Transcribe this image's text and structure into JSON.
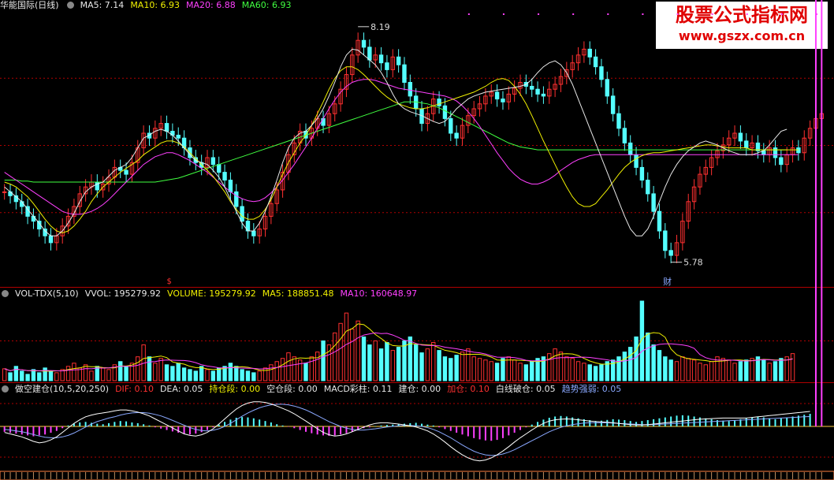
{
  "main_header": {
    "title": "华能国际(日线)",
    "ma5": "MA5: 7.14",
    "ma10": "MA10: 6.93",
    "ma20": "MA20: 6.88",
    "ma60": "MA60: 6.93"
  },
  "main_annotations": {
    "high": "8.19",
    "low": "5.78",
    "marker_s": "$",
    "marker_cai": "财"
  },
  "vol_header": {
    "name": "VOL-TDX(5,10)",
    "vvol": "VVOL: 195279.92",
    "volume": "VOLUME: 195279.92",
    "ma5": "MA5: 188851.48",
    "ma10": "MA10: 160648.97"
  },
  "macd_header": {
    "name": "做空建仓(10,5,20,250)",
    "dif": "DIF: 0.10",
    "dea": "DEA: 0.05",
    "hold": "持仓段: 0.00",
    "empty": "空仓段: 0.00",
    "bar": "MACD彩柱: 0.11",
    "build": "建仓: 0.00",
    "add": "加仓: 0.10",
    "break": "白线破仓: 0.05",
    "trend": "趋势强弱: 0.05"
  },
  "watermark": {
    "title": "股票公式指标网",
    "url": "www.gszx.com.cn"
  },
  "colors": {
    "up": "#ff3030",
    "down": "#54ffff",
    "ma5": "#e8e8e8",
    "ma10": "#f0f000",
    "ma20": "#ff40ff",
    "ma60": "#40ff40",
    "grid": "#b00000"
  },
  "icons": [
    "dot-icon"
  ],
  "chart_data": {
    "type": "candlestick",
    "price_range": [
      5.6,
      8.35
    ],
    "high_mark": 8.19,
    "low_mark": 5.78,
    "closes": [
      6.5,
      6.46,
      6.4,
      6.35,
      6.25,
      6.2,
      6.12,
      6.05,
      5.98,
      6.05,
      6.15,
      6.25,
      6.35,
      6.48,
      6.55,
      6.6,
      6.52,
      6.58,
      6.65,
      6.75,
      6.72,
      6.68,
      6.8,
      6.95,
      7.1,
      7.05,
      7.15,
      7.2,
      7.12,
      7.08,
      7.05,
      6.95,
      6.85,
      6.8,
      6.75,
      6.85,
      6.78,
      6.7,
      6.62,
      6.5,
      6.35,
      6.2,
      6.1,
      6.05,
      6.12,
      6.25,
      6.38,
      6.52,
      6.7,
      6.88,
      7.0,
      7.12,
      7.05,
      7.15,
      7.25,
      7.18,
      7.3,
      7.4,
      7.55,
      7.7,
      7.9,
      8.05,
      7.98,
      7.85,
      7.9,
      7.82,
      7.75,
      7.88,
      7.8,
      7.62,
      7.48,
      7.35,
      7.2,
      7.3,
      7.45,
      7.38,
      7.25,
      7.1,
      7.05,
      7.18,
      7.28,
      7.35,
      7.4,
      7.48,
      7.52,
      7.45,
      7.42,
      7.5,
      7.56,
      7.62,
      7.58,
      7.55,
      7.5,
      7.48,
      7.55,
      7.6,
      7.68,
      7.75,
      7.82,
      7.9,
      7.96,
      7.88,
      7.78,
      7.65,
      7.48,
      7.3,
      7.15,
      7.0,
      6.88,
      6.75,
      6.62,
      6.48,
      6.3,
      6.1,
      5.9,
      5.85,
      5.98,
      6.2,
      6.4,
      6.55,
      6.68,
      6.75,
      6.85,
      6.92,
      6.98,
      7.05,
      7.1,
      7.02,
      6.95,
      7.0,
      6.92,
      6.88,
      6.95,
      6.85,
      6.78,
      6.88,
      6.95,
      6.9,
      7.05,
      7.15,
      7.25,
      7.3
    ],
    "ma5": [
      6.55,
      6.5,
      6.45,
      6.4,
      6.32,
      6.25,
      6.18,
      6.1,
      6.05,
      6.05,
      6.1,
      6.18,
      6.28,
      6.4,
      6.5,
      6.55,
      6.58,
      6.6,
      6.66,
      6.72,
      6.75,
      6.78,
      6.85,
      6.95,
      7.05,
      7.08,
      7.12,
      7.14,
      7.12,
      7.08,
      7.02,
      6.95,
      6.88,
      6.82,
      6.8,
      6.78,
      6.72,
      6.65,
      6.55,
      6.42,
      6.3,
      6.18,
      6.1,
      6.1,
      6.18,
      6.3,
      6.45,
      6.62,
      6.8,
      6.95,
      7.05,
      7.1,
      7.12,
      7.18,
      7.25,
      7.35,
      7.48,
      7.62,
      7.78,
      7.9,
      7.96,
      7.95,
      7.9,
      7.85,
      7.8,
      7.72,
      7.62,
      7.5,
      7.4,
      7.35,
      7.32,
      7.3,
      7.28,
      7.25,
      7.22,
      7.2,
      7.22,
      7.28,
      7.35,
      7.4,
      7.45,
      7.48,
      7.5,
      7.52,
      7.53,
      7.54,
      7.55,
      7.56,
      7.57,
      7.58,
      7.6,
      7.65,
      7.72,
      7.78,
      7.82,
      7.84,
      7.8,
      7.72,
      7.6,
      7.45,
      7.3,
      7.15,
      7.0,
      6.85,
      6.7,
      6.55,
      6.4,
      6.25,
      6.12,
      6.05,
      6.05,
      6.12,
      6.25,
      6.4,
      6.55,
      6.68,
      6.78,
      6.86,
      6.92,
      6.96,
      7.0,
      7.02,
      7.0,
      6.98,
      6.95,
      6.92,
      6.9,
      6.88,
      6.88,
      6.88,
      6.9,
      6.92,
      6.98,
      7.05,
      7.12,
      7.14
    ],
    "ma10": [
      6.6,
      6.58,
      6.55,
      6.5,
      6.45,
      6.38,
      6.3,
      6.22,
      6.15,
      6.1,
      6.08,
      6.1,
      6.15,
      6.22,
      6.3,
      6.4,
      6.48,
      6.55,
      6.6,
      6.65,
      6.7,
      6.74,
      6.78,
      6.82,
      6.88,
      6.92,
      6.96,
      7.0,
      7.02,
      7.02,
      7.0,
      6.96,
      6.9,
      6.84,
      6.78,
      6.72,
      6.66,
      6.58,
      6.5,
      6.4,
      6.32,
      6.25,
      6.22,
      6.22,
      6.25,
      6.32,
      6.42,
      6.55,
      6.68,
      6.8,
      6.9,
      7.0,
      7.08,
      7.18,
      7.3,
      7.42,
      7.55,
      7.66,
      7.74,
      7.78,
      7.78,
      7.75,
      7.7,
      7.64,
      7.58,
      7.52,
      7.47,
      7.43,
      7.4,
      7.38,
      7.36,
      7.35,
      7.35,
      7.36,
      7.38,
      7.4,
      7.42,
      7.44,
      7.46,
      7.48,
      7.5,
      7.52,
      7.55,
      7.58,
      7.62,
      7.65,
      7.66,
      7.64,
      7.58,
      7.5,
      7.4,
      7.28,
      7.15,
      7.02,
      6.9,
      6.78,
      6.66,
      6.55,
      6.45,
      6.38,
      6.35,
      6.35,
      6.38,
      6.45,
      6.52,
      6.6,
      6.68,
      6.75,
      6.8,
      6.84,
      6.87,
      6.89,
      6.9,
      6.9,
      6.91,
      6.92,
      6.93,
      6.94,
      6.95,
      6.96,
      6.97,
      6.98,
      6.98,
      6.97,
      6.96,
      6.95,
      6.95,
      6.95,
      6.95,
      6.93,
      6.93,
      6.93,
      6.93,
      6.93,
      6.93,
      6.93,
      6.93,
      6.93
    ],
    "ma20": [
      6.7,
      6.66,
      6.62,
      6.58,
      6.54,
      6.5,
      6.46,
      6.42,
      6.38,
      6.34,
      6.3,
      6.28,
      6.27,
      6.27,
      6.28,
      6.3,
      6.33,
      6.37,
      6.42,
      6.48,
      6.54,
      6.6,
      6.66,
      6.72,
      6.78,
      6.82,
      6.86,
      6.88,
      6.9,
      6.9,
      6.88,
      6.85,
      6.82,
      6.78,
      6.74,
      6.7,
      6.65,
      6.6,
      6.55,
      6.5,
      6.46,
      6.43,
      6.41,
      6.4,
      6.41,
      6.44,
      6.49,
      6.55,
      6.62,
      6.7,
      6.78,
      6.87,
      6.96,
      7.05,
      7.15,
      7.25,
      7.35,
      7.44,
      7.52,
      7.58,
      7.62,
      7.64,
      7.65,
      7.65,
      7.64,
      7.62,
      7.6,
      7.58,
      7.56,
      7.55,
      7.54,
      7.53,
      7.52,
      7.51,
      7.5,
      7.49,
      7.48,
      7.46,
      7.43,
      7.38,
      7.32,
      7.25,
      7.17,
      7.08,
      6.99,
      6.9,
      6.82,
      6.74,
      6.68,
      6.63,
      6.6,
      6.58,
      6.58,
      6.6,
      6.63,
      6.67,
      6.72,
      6.76,
      6.8,
      6.83,
      6.85,
      6.87,
      6.88,
      6.88,
      6.88,
      6.88,
      6.88,
      6.88,
      6.88,
      6.88,
      6.88,
      6.88,
      6.88,
      6.88,
      6.88,
      6.88,
      6.88,
      6.88,
      6.88,
      6.88,
      6.88,
      6.88,
      6.88,
      6.88,
      6.88,
      6.88,
      6.88,
      6.88,
      6.88,
      6.88,
      6.88,
      6.88,
      6.88,
      6.88,
      6.88,
      6.88,
      6.88,
      6.88
    ],
    "ma60": [
      6.62,
      6.62,
      6.62,
      6.61,
      6.61,
      6.6,
      6.6,
      6.6,
      6.6,
      6.6,
      6.6,
      6.6,
      6.6,
      6.6,
      6.6,
      6.6,
      6.6,
      6.6,
      6.6,
      6.6,
      6.6,
      6.6,
      6.6,
      6.6,
      6.6,
      6.6,
      6.6,
      6.61,
      6.62,
      6.63,
      6.64,
      6.66,
      6.68,
      6.7,
      6.72,
      6.74,
      6.76,
      6.78,
      6.8,
      6.82,
      6.84,
      6.86,
      6.88,
      6.9,
      6.92,
      6.94,
      6.96,
      6.98,
      7.0,
      7.02,
      7.04,
      7.06,
      7.08,
      7.1,
      7.12,
      7.14,
      7.16,
      7.18,
      7.2,
      7.22,
      7.24,
      7.26,
      7.28,
      7.3,
      7.32,
      7.34,
      7.36,
      7.38,
      7.4,
      7.42,
      7.42,
      7.42,
      7.41,
      7.4,
      7.38,
      7.36,
      7.33,
      7.3,
      7.27,
      7.24,
      7.21,
      7.18,
      7.15,
      7.12,
      7.09,
      7.06,
      7.03,
      7.0,
      6.98,
      6.96,
      6.95,
      6.94,
      6.93,
      6.93,
      6.93,
      6.93,
      6.93,
      6.93,
      6.93,
      6.93,
      6.93,
      6.93,
      6.93,
      6.93,
      6.93,
      6.93,
      6.93,
      6.93,
      6.93,
      6.93,
      6.93,
      6.93,
      6.93,
      6.93,
      6.93,
      6.93,
      6.93,
      6.93,
      6.93,
      6.93,
      6.93,
      6.93,
      6.93,
      6.93,
      6.93,
      6.93,
      6.93,
      6.93,
      6.93,
      6.93,
      6.93,
      6.93,
      6.93,
      6.93,
      6.93,
      6.93
    ],
    "volume_rel": [
      0.15,
      0.1,
      0.18,
      0.12,
      0.08,
      0.14,
      0.1,
      0.16,
      0.12,
      0.1,
      0.14,
      0.18,
      0.22,
      0.16,
      0.2,
      0.12,
      0.18,
      0.16,
      0.14,
      0.2,
      0.24,
      0.18,
      0.22,
      0.3,
      0.45,
      0.3,
      0.22,
      0.28,
      0.2,
      0.18,
      0.22,
      0.16,
      0.14,
      0.12,
      0.18,
      0.14,
      0.12,
      0.16,
      0.18,
      0.22,
      0.18,
      0.14,
      0.12,
      0.1,
      0.12,
      0.16,
      0.2,
      0.24,
      0.28,
      0.35,
      0.3,
      0.26,
      0.22,
      0.3,
      0.36,
      0.5,
      0.45,
      0.6,
      0.72,
      0.85,
      0.65,
      0.75,
      0.55,
      0.45,
      0.5,
      0.4,
      0.48,
      0.38,
      0.42,
      0.5,
      0.55,
      0.45,
      0.35,
      0.4,
      0.48,
      0.38,
      0.3,
      0.28,
      0.32,
      0.36,
      0.4,
      0.3,
      0.28,
      0.26,
      0.24,
      0.22,
      0.28,
      0.3,
      0.26,
      0.22,
      0.2,
      0.24,
      0.28,
      0.3,
      0.34,
      0.4,
      0.36,
      0.3,
      0.28,
      0.24,
      0.22,
      0.2,
      0.18,
      0.2,
      0.24,
      0.26,
      0.3,
      0.36,
      0.42,
      0.55,
      1.0,
      0.6,
      0.45,
      0.38,
      0.3,
      0.26,
      0.24,
      0.3,
      0.28,
      0.26,
      0.22,
      0.2,
      0.24,
      0.3,
      0.28,
      0.26,
      0.22,
      0.24,
      0.26,
      0.28,
      0.3,
      0.26,
      0.22,
      0.24,
      0.28,
      0.3,
      0.34
    ],
    "macd_rel": [
      -0.3,
      -0.35,
      -0.4,
      -0.45,
      -0.5,
      -0.55,
      -0.5,
      -0.45,
      -0.35,
      -0.25,
      -0.1,
      0.05,
      0.15,
      0.22,
      0.25,
      0.2,
      0.15,
      0.12,
      0.18,
      0.25,
      0.3,
      0.28,
      0.22,
      0.18,
      0.12,
      0.05,
      -0.05,
      -0.12,
      -0.2,
      -0.28,
      -0.35,
      -0.42,
      -0.45,
      -0.4,
      -0.32,
      -0.2,
      -0.05,
      0.1,
      0.25,
      0.38,
      0.48,
      0.52,
      0.5,
      0.45,
      0.38,
      0.3,
      0.22,
      0.12,
      0.05,
      -0.02,
      -0.1,
      -0.2,
      -0.3,
      -0.38,
      -0.45,
      -0.5,
      -0.52,
      -0.5,
      -0.45,
      -0.38,
      -0.3,
      -0.2,
      -0.1,
      -0.05,
      0.02,
      0.05,
      0.08,
      0.1,
      0.12,
      0.15,
      0.18,
      0.2,
      0.15,
      0.1,
      0.05,
      -0.05,
      -0.15,
      -0.25,
      -0.35,
      -0.45,
      -0.55,
      -0.65,
      -0.72,
      -0.78,
      -0.8,
      -0.75,
      -0.65,
      -0.5,
      -0.35,
      -0.2,
      -0.05,
      0.1,
      0.25,
      0.38,
      0.48,
      0.55,
      0.58,
      0.55,
      0.5,
      0.45,
      0.4,
      0.35,
      0.3,
      0.32,
      0.36,
      0.4,
      0.38,
      0.35,
      0.3,
      0.25,
      0.3,
      0.35,
      0.4,
      0.45,
      0.5,
      0.55,
      0.6,
      0.62,
      0.6,
      0.55,
      0.5,
      0.45,
      0.4,
      0.35,
      0.32,
      0.3,
      0.35,
      0.4,
      0.45,
      0.5,
      0.55,
      0.5,
      0.45,
      0.4,
      0.45,
      0.5,
      0.55,
      0.6,
      0.65,
      0.7
    ],
    "dif_rel": [
      -0.2,
      -0.25,
      -0.3,
      -0.35,
      -0.42,
      -0.5,
      -0.55,
      -0.52,
      -0.45,
      -0.35,
      -0.2,
      -0.05,
      0.1,
      0.22,
      0.32,
      0.38,
      0.42,
      0.45,
      0.48,
      0.52,
      0.55,
      0.55,
      0.52,
      0.48,
      0.42,
      0.35,
      0.25,
      0.15,
      0.05,
      -0.05,
      -0.15,
      -0.25,
      -0.3,
      -0.32,
      -0.28,
      -0.2,
      -0.08,
      0.08,
      0.25,
      0.42,
      0.58,
      0.7,
      0.78,
      0.82,
      0.82,
      0.8,
      0.75,
      0.68,
      0.6,
      0.52,
      0.42,
      0.3,
      0.18,
      0.05,
      -0.08,
      -0.2,
      -0.28,
      -0.32,
      -0.3,
      -0.25,
      -0.18,
      -0.1,
      -0.02,
      0.05,
      0.1,
      0.12,
      0.12,
      0.1,
      0.08,
      0.05,
      0.02,
      -0.02,
      -0.08,
      -0.15,
      -0.25,
      -0.38,
      -0.52,
      -0.68,
      -0.82,
      -0.95,
      -1.05,
      -1.12,
      -1.15,
      -1.12,
      -1.05,
      -0.95,
      -0.82,
      -0.68,
      -0.52,
      -0.38,
      -0.25,
      -0.12,
      0.0,
      0.1,
      0.18,
      0.22,
      0.24,
      0.25,
      0.24,
      0.22,
      0.2,
      0.18,
      0.16,
      0.15,
      0.14,
      0.12,
      0.1,
      0.08,
      0.06,
      0.05,
      0.05,
      0.06,
      0.08,
      0.1,
      0.12,
      0.14,
      0.16,
      0.18,
      0.2,
      0.22,
      0.24,
      0.25,
      0.26,
      0.27,
      0.28,
      0.28,
      0.28,
      0.28,
      0.28,
      0.3,
      0.32,
      0.34,
      0.36,
      0.38,
      0.4,
      0.42,
      0.44,
      0.46,
      0.48,
      0.5
    ],
    "dea_rel": [
      -0.1,
      -0.12,
      -0.15,
      -0.18,
      -0.22,
      -0.27,
      -0.32,
      -0.36,
      -0.38,
      -0.38,
      -0.35,
      -0.3,
      -0.22,
      -0.12,
      -0.02,
      0.08,
      0.16,
      0.22,
      0.28,
      0.32,
      0.38,
      0.42,
      0.45,
      0.46,
      0.46,
      0.44,
      0.4,
      0.35,
      0.28,
      0.2,
      0.12,
      0.04,
      -0.04,
      -0.1,
      -0.14,
      -0.15,
      -0.13,
      -0.08,
      0.0,
      0.1,
      0.22,
      0.34,
      0.45,
      0.54,
      0.62,
      0.68,
      0.72,
      0.74,
      0.74,
      0.72,
      0.68,
      0.62,
      0.55,
      0.46,
      0.36,
      0.26,
      0.16,
      0.08,
      0.0,
      -0.06,
      -0.1,
      -0.12,
      -0.12,
      -0.1,
      -0.08,
      -0.05,
      -0.02,
      0.0,
      0.02,
      0.03,
      0.03,
      0.02,
      0.0,
      -0.04,
      -0.1,
      -0.18,
      -0.28,
      -0.38,
      -0.5,
      -0.62,
      -0.73,
      -0.83,
      -0.9,
      -0.95,
      -0.97,
      -0.96,
      -0.92,
      -0.86,
      -0.78,
      -0.68,
      -0.58,
      -0.48,
      -0.38,
      -0.28,
      -0.18,
      -0.1,
      -0.03,
      0.02,
      0.06,
      0.09,
      0.11,
      0.12,
      0.12,
      0.12,
      0.12,
      0.11,
      0.1,
      0.09,
      0.08,
      0.07,
      0.06,
      0.06,
      0.06,
      0.07,
      0.08,
      0.09,
      0.1,
      0.11,
      0.12,
      0.13,
      0.14,
      0.15,
      0.16,
      0.17,
      0.18,
      0.19,
      0.2,
      0.21,
      0.22,
      0.23,
      0.24,
      0.25,
      0.26,
      0.27,
      0.28,
      0.29,
      0.3,
      0.31,
      0.32,
      0.33
    ]
  }
}
